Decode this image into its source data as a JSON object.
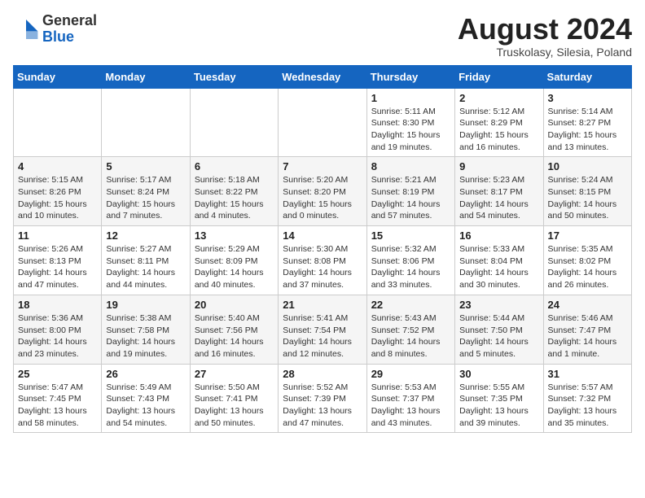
{
  "logo": {
    "general": "General",
    "blue": "Blue"
  },
  "header": {
    "month_year": "August 2024",
    "location": "Truskolasy, Silesia, Poland"
  },
  "days_of_week": [
    "Sunday",
    "Monday",
    "Tuesday",
    "Wednesday",
    "Thursday",
    "Friday",
    "Saturday"
  ],
  "weeks": [
    [
      {
        "day": "",
        "info": ""
      },
      {
        "day": "",
        "info": ""
      },
      {
        "day": "",
        "info": ""
      },
      {
        "day": "",
        "info": ""
      },
      {
        "day": "1",
        "info": "Sunrise: 5:11 AM\nSunset: 8:30 PM\nDaylight: 15 hours\nand 19 minutes."
      },
      {
        "day": "2",
        "info": "Sunrise: 5:12 AM\nSunset: 8:29 PM\nDaylight: 15 hours\nand 16 minutes."
      },
      {
        "day": "3",
        "info": "Sunrise: 5:14 AM\nSunset: 8:27 PM\nDaylight: 15 hours\nand 13 minutes."
      }
    ],
    [
      {
        "day": "4",
        "info": "Sunrise: 5:15 AM\nSunset: 8:26 PM\nDaylight: 15 hours\nand 10 minutes."
      },
      {
        "day": "5",
        "info": "Sunrise: 5:17 AM\nSunset: 8:24 PM\nDaylight: 15 hours\nand 7 minutes."
      },
      {
        "day": "6",
        "info": "Sunrise: 5:18 AM\nSunset: 8:22 PM\nDaylight: 15 hours\nand 4 minutes."
      },
      {
        "day": "7",
        "info": "Sunrise: 5:20 AM\nSunset: 8:20 PM\nDaylight: 15 hours\nand 0 minutes."
      },
      {
        "day": "8",
        "info": "Sunrise: 5:21 AM\nSunset: 8:19 PM\nDaylight: 14 hours\nand 57 minutes."
      },
      {
        "day": "9",
        "info": "Sunrise: 5:23 AM\nSunset: 8:17 PM\nDaylight: 14 hours\nand 54 minutes."
      },
      {
        "day": "10",
        "info": "Sunrise: 5:24 AM\nSunset: 8:15 PM\nDaylight: 14 hours\nand 50 minutes."
      }
    ],
    [
      {
        "day": "11",
        "info": "Sunrise: 5:26 AM\nSunset: 8:13 PM\nDaylight: 14 hours\nand 47 minutes."
      },
      {
        "day": "12",
        "info": "Sunrise: 5:27 AM\nSunset: 8:11 PM\nDaylight: 14 hours\nand 44 minutes."
      },
      {
        "day": "13",
        "info": "Sunrise: 5:29 AM\nSunset: 8:09 PM\nDaylight: 14 hours\nand 40 minutes."
      },
      {
        "day": "14",
        "info": "Sunrise: 5:30 AM\nSunset: 8:08 PM\nDaylight: 14 hours\nand 37 minutes."
      },
      {
        "day": "15",
        "info": "Sunrise: 5:32 AM\nSunset: 8:06 PM\nDaylight: 14 hours\nand 33 minutes."
      },
      {
        "day": "16",
        "info": "Sunrise: 5:33 AM\nSunset: 8:04 PM\nDaylight: 14 hours\nand 30 minutes."
      },
      {
        "day": "17",
        "info": "Sunrise: 5:35 AM\nSunset: 8:02 PM\nDaylight: 14 hours\nand 26 minutes."
      }
    ],
    [
      {
        "day": "18",
        "info": "Sunrise: 5:36 AM\nSunset: 8:00 PM\nDaylight: 14 hours\nand 23 minutes."
      },
      {
        "day": "19",
        "info": "Sunrise: 5:38 AM\nSunset: 7:58 PM\nDaylight: 14 hours\nand 19 minutes."
      },
      {
        "day": "20",
        "info": "Sunrise: 5:40 AM\nSunset: 7:56 PM\nDaylight: 14 hours\nand 16 minutes."
      },
      {
        "day": "21",
        "info": "Sunrise: 5:41 AM\nSunset: 7:54 PM\nDaylight: 14 hours\nand 12 minutes."
      },
      {
        "day": "22",
        "info": "Sunrise: 5:43 AM\nSunset: 7:52 PM\nDaylight: 14 hours\nand 8 minutes."
      },
      {
        "day": "23",
        "info": "Sunrise: 5:44 AM\nSunset: 7:50 PM\nDaylight: 14 hours\nand 5 minutes."
      },
      {
        "day": "24",
        "info": "Sunrise: 5:46 AM\nSunset: 7:47 PM\nDaylight: 14 hours\nand 1 minute."
      }
    ],
    [
      {
        "day": "25",
        "info": "Sunrise: 5:47 AM\nSunset: 7:45 PM\nDaylight: 13 hours\nand 58 minutes."
      },
      {
        "day": "26",
        "info": "Sunrise: 5:49 AM\nSunset: 7:43 PM\nDaylight: 13 hours\nand 54 minutes."
      },
      {
        "day": "27",
        "info": "Sunrise: 5:50 AM\nSunset: 7:41 PM\nDaylight: 13 hours\nand 50 minutes."
      },
      {
        "day": "28",
        "info": "Sunrise: 5:52 AM\nSunset: 7:39 PM\nDaylight: 13 hours\nand 47 minutes."
      },
      {
        "day": "29",
        "info": "Sunrise: 5:53 AM\nSunset: 7:37 PM\nDaylight: 13 hours\nand 43 minutes."
      },
      {
        "day": "30",
        "info": "Sunrise: 5:55 AM\nSunset: 7:35 PM\nDaylight: 13 hours\nand 39 minutes."
      },
      {
        "day": "31",
        "info": "Sunrise: 5:57 AM\nSunset: 7:32 PM\nDaylight: 13 hours\nand 35 minutes."
      }
    ]
  ]
}
